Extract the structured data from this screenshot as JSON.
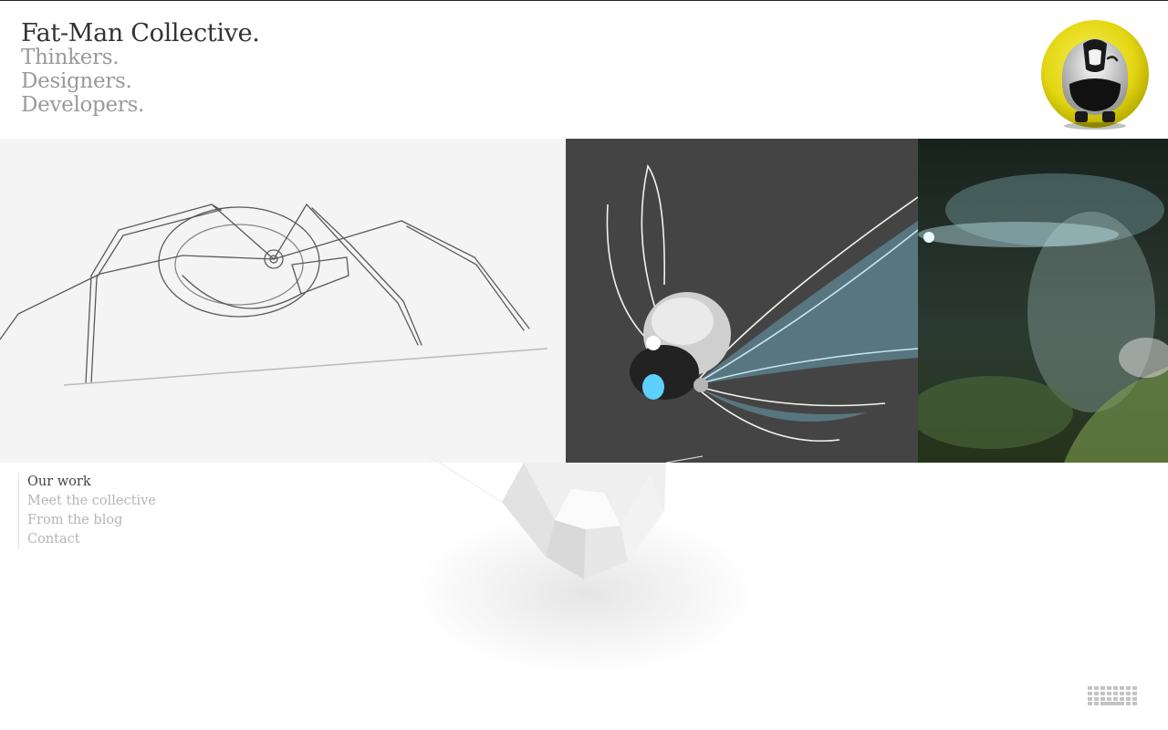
{
  "brand": {
    "title": "Fat-Man Collective.",
    "taglines": [
      "Thinkers.",
      "Designers.",
      "Developers."
    ]
  },
  "header": {
    "mascot_icon": "robot-mascot-icon"
  },
  "gallery": {
    "panels": [
      {
        "name": "spider-robot-sketch"
      },
      {
        "name": "robot-firefly-render"
      },
      {
        "name": "glowing-firefly-scene"
      }
    ]
  },
  "nav": {
    "items": [
      {
        "label": "Our work",
        "active": true
      },
      {
        "label": "Meet the collective",
        "active": false
      },
      {
        "label": "From the blog",
        "active": false
      },
      {
        "label": "Contact",
        "active": false
      }
    ]
  },
  "footer": {
    "keyboard_icon": "keyboard-icon"
  },
  "colors": {
    "mascot_yellow": "#e6db1a",
    "render_bg": "#444444",
    "glow_blue": "#7fd4f0",
    "active_nav": "#444444",
    "inactive_nav": "#b5b5b5"
  }
}
